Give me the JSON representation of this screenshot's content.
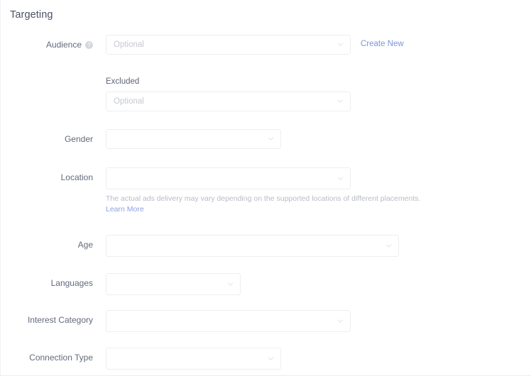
{
  "panel": {
    "title": "Targeting",
    "help_icon": "help-circle-icon",
    "chevron_icon": "chevron-down-icon"
  },
  "fields": {
    "audience": {
      "label": "Audience",
      "placeholder": "Optional",
      "value": "",
      "create_new_label": "Create New",
      "has_help_icon": true
    },
    "excluded": {
      "label": "Excluded",
      "placeholder": "Optional",
      "value": ""
    },
    "gender": {
      "label": "Gender",
      "placeholder": "",
      "value": ""
    },
    "location": {
      "label": "Location",
      "placeholder": "",
      "value": "",
      "helper_text": "The actual ads delivery may vary depending on the supported locations of different placements.",
      "helper_link": "Learn More"
    },
    "age": {
      "label": "Age",
      "placeholder": "",
      "value": ""
    },
    "languages": {
      "label": "Languages",
      "placeholder": "",
      "value": ""
    },
    "interest_category": {
      "label": "Interest Category",
      "placeholder": "",
      "value": ""
    },
    "connection_type": {
      "label": "Connection Type",
      "placeholder": "",
      "value": ""
    }
  },
  "colors": {
    "link": "#7f95d6",
    "label_text": "#646a7c",
    "placeholder": "#c6c9d2",
    "border": "#edeef1",
    "title": "#4c5163"
  }
}
